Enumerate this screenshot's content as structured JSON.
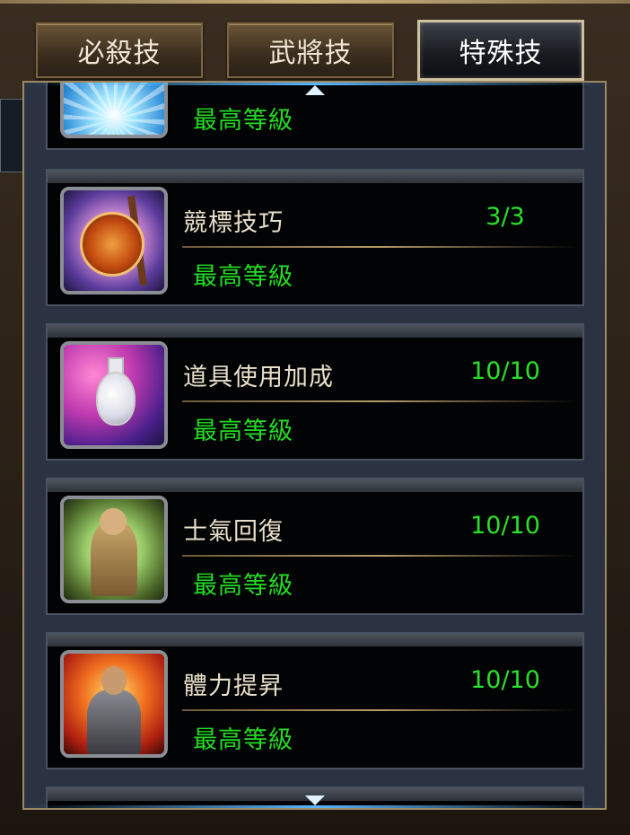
{
  "tabs": [
    {
      "label": "必殺技",
      "active": false
    },
    {
      "label": "武將技",
      "active": false
    },
    {
      "label": "特殊技",
      "active": true
    }
  ],
  "skills": [
    {
      "name": "",
      "level": "",
      "status": "最高等級",
      "icon": "light-burst-icon"
    },
    {
      "name": "競標技巧",
      "level": "3/3",
      "status": "最高等級",
      "icon": "gong-drum-icon"
    },
    {
      "name": "道具使用加成",
      "level": "10/10",
      "status": "最高等級",
      "icon": "potion-bottle-icon"
    },
    {
      "name": "士氣回復",
      "level": "10/10",
      "status": "最高等級",
      "icon": "warrior-icon"
    },
    {
      "name": "體力提昇",
      "level": "10/10",
      "status": "最高等級",
      "icon": "armored-soldier-icon"
    }
  ],
  "colors": {
    "level_green": "#2ae02a",
    "name_text": "#e9dfca",
    "panel_border": "#9b8a62"
  }
}
